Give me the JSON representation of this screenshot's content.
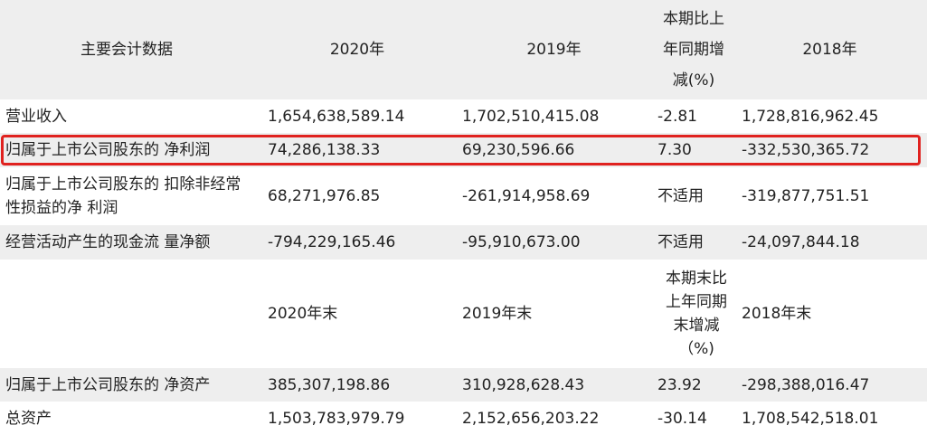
{
  "header": {
    "col0": "主要会计数据",
    "col1": "2020年",
    "col2": "2019年",
    "col3_lines": [
      "本期比上",
      "年同期增",
      "减(%)"
    ],
    "col4": "2018年"
  },
  "rows": [
    {
      "label": "营业收入",
      "v2020": "1,654,638,589.14",
      "v2019": "1,702,510,415.08",
      "change": "-2.81",
      "v2018": "1,728,816,962.45"
    },
    {
      "label": "归属于上市公司股东的 净利润",
      "v2020": "74,286,138.33",
      "v2019": "69,230,596.66",
      "change": "7.30",
      "v2018": "-332,530,365.72"
    },
    {
      "label_lines": [
        "归属于上市公司股东的 扣除非经常",
        "性损益的净 利润"
      ],
      "v2020": "68,271,976.85",
      "v2019": "-261,914,958.69",
      "change": "不适用",
      "v2018": "-319,877,751.51"
    },
    {
      "label": "经营活动产生的现金流 量净额",
      "v2020": "-794,229,165.46",
      "v2019": "-95,910,673.00",
      "change": "不适用",
      "v2018": "-24,097,844.18"
    }
  ],
  "subheader": {
    "col1": "2020年末",
    "col2": "2019年末",
    "col3_lines": [
      "本期末比",
      "上年同期",
      "末增减",
      "（%)"
    ],
    "col4": "2018年末"
  },
  "rows2": [
    {
      "label": "归属于上市公司股东的 净资产",
      "v2020": "385,307,198.86",
      "v2019": "310,928,628.43",
      "change": "23.92",
      "v2018": "-298,388,016.47"
    },
    {
      "label": "总资产",
      "v2020": "1,503,783,979.79",
      "v2019": "2,152,656,203.22",
      "change": "-30.14",
      "v2018": "1,708,542,518.01"
    }
  ],
  "colors": {
    "shade": "#eeeeee",
    "highlight": "#e0221f"
  }
}
